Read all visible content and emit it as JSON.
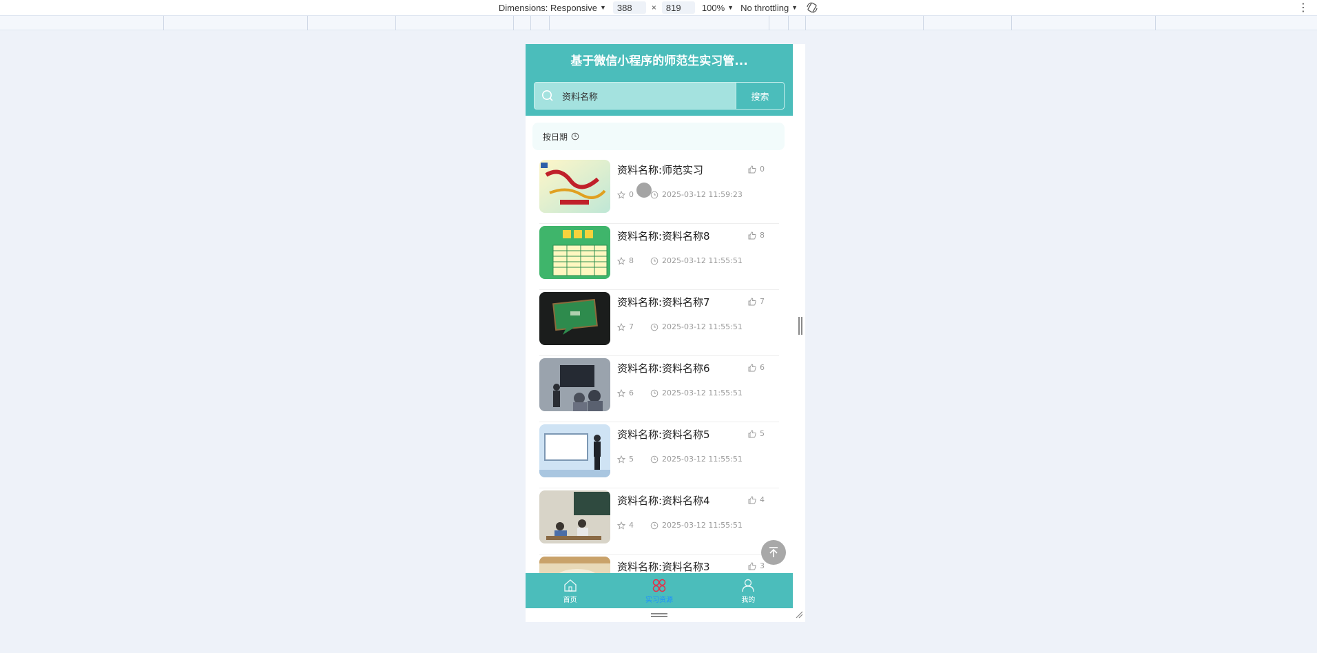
{
  "devtools": {
    "dimensions_label": "Dimensions: Responsive",
    "width_value": "388",
    "times": "×",
    "height_value": "819",
    "zoom": "100%",
    "throttling": "No throttling"
  },
  "app": {
    "title": "基于微信小程序的师范生实习管...",
    "search": {
      "value": "资料名称",
      "button": "搜索"
    },
    "sort_label": "按日期",
    "items": [
      {
        "name": "资料名称:师范实习",
        "likes": "0",
        "favorites": "0",
        "date": "2025-03-12 11:59:23"
      },
      {
        "name": "资料名称:资料名称8",
        "likes": "8",
        "favorites": "8",
        "date": "2025-03-12 11:55:51"
      },
      {
        "name": "资料名称:资料名称7",
        "likes": "7",
        "favorites": "7",
        "date": "2025-03-12 11:55:51"
      },
      {
        "name": "资料名称:资料名称6",
        "likes": "6",
        "favorites": "6",
        "date": "2025-03-12 11:55:51"
      },
      {
        "name": "资料名称:资料名称5",
        "likes": "5",
        "favorites": "5",
        "date": "2025-03-12 11:55:51"
      },
      {
        "name": "资料名称:资料名称4",
        "likes": "4",
        "favorites": "4",
        "date": "2025-03-12 11:55:51"
      },
      {
        "name": "资料名称:资料名称3",
        "likes": "3",
        "favorites": "",
        "date": ""
      }
    ],
    "tabs": [
      {
        "label": "首页",
        "icon": "home-icon"
      },
      {
        "label": "实习资源",
        "icon": "grid-icon"
      },
      {
        "label": "我的",
        "icon": "user-icon"
      }
    ]
  },
  "colors": {
    "accent": "#4bbdbb",
    "search_bg": "#a4e2df",
    "active_tab": "#1e90ff",
    "page_bg": "#eef2f9"
  }
}
